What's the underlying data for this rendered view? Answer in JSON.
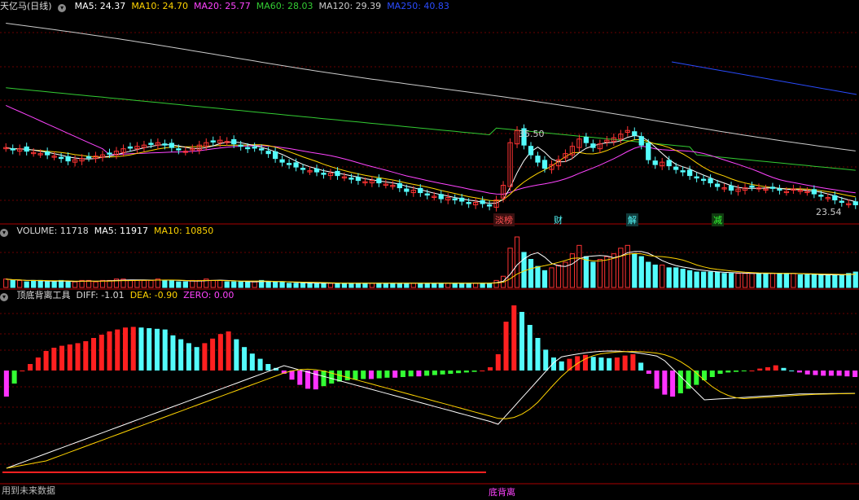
{
  "panels": {
    "main": {
      "title": "天亿马(日线)",
      "ma": [
        {
          "label": "MA5: 24.37",
          "color": "#ffffff"
        },
        {
          "label": "MA10: 24.70",
          "color": "#ffd400"
        },
        {
          "label": "MA20: 25.77",
          "color": "#ff44ff"
        },
        {
          "label": "MA60: 28.03",
          "color": "#33cc33"
        },
        {
          "label": "MA120: 29.39",
          "color": "#cccccc"
        },
        {
          "label": "MA250: 40.83",
          "color": "#2a4cff"
        }
      ],
      "high_label": "35.50",
      "low_label": "23.54",
      "events": [
        "淡榜",
        "财",
        "解",
        "减"
      ]
    },
    "volume": {
      "items": [
        {
          "label": "VOLUME: 11718",
          "color": "#dddddd"
        },
        {
          "label": "MA5: 11917",
          "color": "#ffffff"
        },
        {
          "label": "MA10: 10850",
          "color": "#ffd400"
        }
      ]
    },
    "indicator": {
      "items": [
        {
          "label": "顶底背离工具",
          "color": "#dddddd"
        },
        {
          "label": "DIFF: -1.01",
          "color": "#dddddd"
        },
        {
          "label": "DEA: -0.90",
          "color": "#ffd400"
        },
        {
          "label": "ZERO: 0.00",
          "color": "#ff44ff"
        }
      ],
      "divergence_label": "底背离"
    }
  },
  "footer_text": "用到未来数据",
  "colors": {
    "up": "#ff3333",
    "down": "#54fcfc",
    "pos_hist": "#ff2020",
    "pos_hist_fall": "#54fcfc",
    "neg_hist": "#ff33ff",
    "neg_hist_rise": "#33ff33"
  },
  "chart_data": {
    "type": "candlestick",
    "close": [
      26.6,
      26.4,
      26.5,
      26.3,
      26.2,
      26.1,
      26,
      25.9,
      25.7,
      25.5,
      25.6,
      25.7,
      25.8,
      25.9,
      26,
      26.1,
      26.3,
      26.5,
      26.6,
      26.7,
      26.8,
      26.9,
      27.0,
      26.8,
      26.6,
      26.4,
      26.3,
      26.5,
      26.8,
      27.0,
      27.1,
      27.2,
      27.1,
      26.9,
      26.7,
      26.5,
      26.6,
      26.4,
      26.1,
      25.7,
      25.4,
      25.2,
      25.0,
      24.8,
      24.7,
      24.6,
      24.4,
      24.5,
      24.3,
      24.2,
      24.0,
      23.9,
      23.8,
      23.9,
      23.7,
      23.6,
      23.5,
      23.3,
      23.0,
      23.1,
      22.9,
      22.7,
      22.6,
      22.4,
      22.5,
      22.3,
      22.2,
      22.0,
      22.1,
      22.0,
      21.8,
      22.3,
      23.5,
      27.0,
      28.0,
      26.8,
      26.0,
      25.4,
      24.9,
      25.2,
      25.6,
      26.1,
      26.7,
      27.3,
      27.0,
      26.6,
      26.9,
      27.2,
      27.4,
      27.7,
      28.0,
      27.6,
      26.8,
      25.6,
      25.2,
      25.4,
      25.1,
      24.8,
      24.6,
      24.3,
      24.1,
      23.9,
      23.7,
      23.4,
      23.3,
      23.1,
      23.2,
      23.3,
      23.4,
      23.3,
      23.2,
      23.3,
      23.1,
      23.0,
      23.2,
      23.1,
      23.0,
      22.8,
      22.6,
      22.5,
      22.3,
      22.1,
      22.0,
      21.9
    ],
    "volume": [
      6,
      5,
      5,
      4,
      5,
      5,
      4,
      4,
      5,
      4,
      4,
      5,
      5,
      4,
      5,
      5,
      6,
      6,
      5,
      5,
      5,
      5,
      6,
      5,
      5,
      4,
      4,
      5,
      5,
      6,
      5,
      5,
      4,
      4,
      4,
      4,
      4,
      5,
      4,
      4,
      4,
      3,
      3,
      3,
      3,
      3,
      3,
      3,
      3,
      3,
      3,
      3,
      3,
      3,
      3,
      3,
      3,
      3,
      3,
      3,
      3,
      3,
      3,
      3,
      3,
      3,
      3,
      3,
      3,
      3,
      3,
      5,
      8,
      28,
      36,
      25,
      20,
      15,
      12,
      14,
      16,
      18,
      24,
      30,
      22,
      18,
      20,
      22,
      24,
      28,
      30,
      24,
      22,
      18,
      16,
      16,
      14,
      14,
      13,
      12,
      11,
      11,
      11,
      11,
      10,
      10,
      10,
      10,
      10,
      10,
      10,
      10,
      10,
      10,
      10,
      9,
      9,
      9,
      9,
      9,
      9,
      9,
      10,
      11
    ],
    "ma_series": [
      "MA5",
      "MA10",
      "MA20",
      "MA60",
      "MA120",
      "MA250"
    ],
    "histogram": [
      -4,
      -2,
      0,
      1,
      2,
      3,
      3.5,
      3.8,
      4,
      4.2,
      4.5,
      5,
      5.5,
      6,
      6.3,
      6.6,
      6.7,
      6.6,
      6.5,
      6.4,
      6.3,
      5.4,
      4.8,
      4.2,
      3.6,
      4.2,
      4.9,
      5.6,
      6.0,
      4.8,
      3.6,
      2.6,
      1.8,
      1.0,
      0.4,
      -0.5,
      -1.4,
      -2.2,
      -2.8,
      -2.9,
      -2.4,
      -2.0,
      -1.7,
      -1.5,
      -1.4,
      -1.3,
      -1.3,
      -1.2,
      -1.1,
      -1.1,
      -1.0,
      -0.9,
      -0.9,
      -0.8,
      -0.7,
      -0.6,
      -0.5,
      -0.4,
      -0.3,
      -0.2,
      0,
      0.5,
      2.5,
      7.5,
      10.0,
      9.0,
      7.0,
      5.0,
      3.2,
      2.0,
      1.4,
      1.8,
      2.2,
      2.4,
      2.1,
      2.0,
      1.9,
      2.0,
      2.3,
      2.5,
      1.2,
      -0.5,
      -2.8,
      -3.7,
      -4.0,
      -3.5,
      -2.8,
      -2.2,
      -1.5,
      -1.0,
      -0.5,
      -0.3,
      -0.2,
      -0.1,
      0,
      0.3,
      0.5,
      0.8,
      0.4,
      0,
      -0.3,
      -0.6,
      -0.7,
      -0.8,
      -0.8,
      -0.8,
      -0.9,
      -1.0
    ]
  }
}
